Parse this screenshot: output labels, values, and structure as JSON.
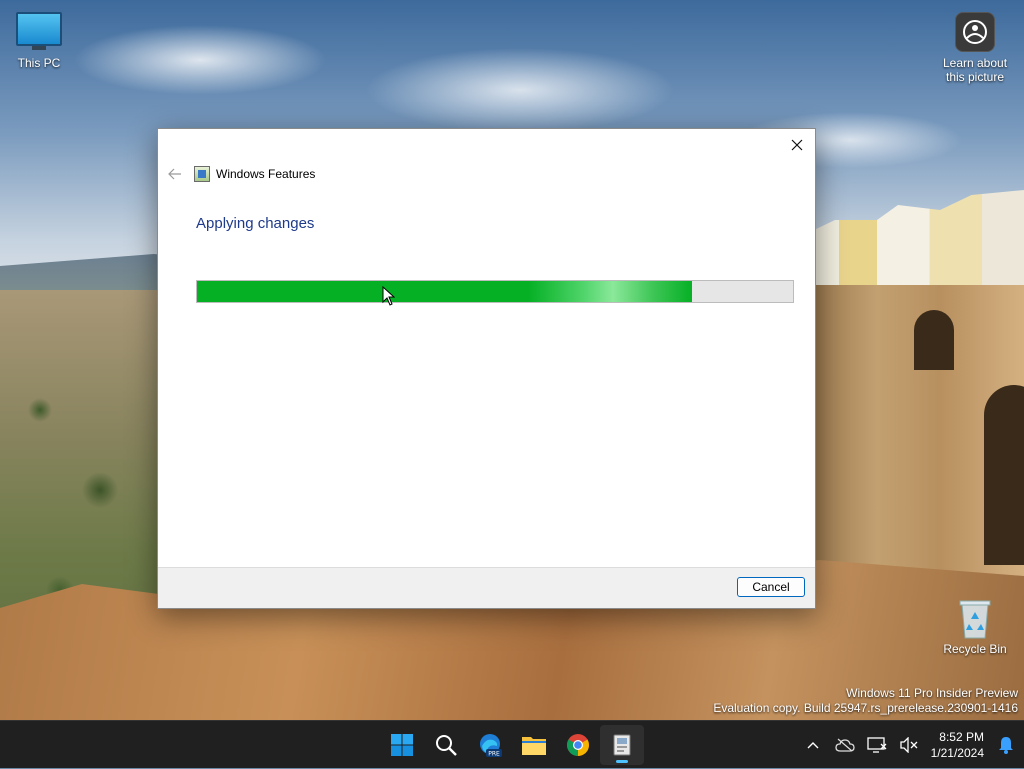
{
  "desktop": {
    "icons": [
      {
        "label": "This PC"
      },
      {
        "label": "Learn about this picture"
      },
      {
        "label": "Recycle Bin"
      }
    ],
    "watermark": {
      "line1": "Windows 11 Pro Insider Preview",
      "line2": "Evaluation copy. Build 25947.rs_prerelease.230901-1416"
    }
  },
  "dialog": {
    "title": "Windows Features",
    "heading": "Applying changes",
    "progress_percent": 83,
    "cancel_label": "Cancel"
  },
  "taskbar": {
    "apps": [
      {
        "name": "Start",
        "icon": "windows-logo-icon"
      },
      {
        "name": "Search",
        "icon": "search-icon"
      },
      {
        "name": "Microsoft Edge Preview",
        "icon": "edge-icon",
        "badge": "PRE"
      },
      {
        "name": "File Explorer",
        "icon": "folder-icon"
      },
      {
        "name": "Google Chrome",
        "icon": "chrome-icon"
      },
      {
        "name": "Windows Features",
        "icon": "windows-features-icon",
        "active": true
      }
    ],
    "time": "8:52 PM",
    "date": "1/21/2024"
  },
  "colors": {
    "progress": "#06b025",
    "accent": "#0067c0",
    "heading": "#1e3a8a",
    "taskbar": "#202020"
  }
}
